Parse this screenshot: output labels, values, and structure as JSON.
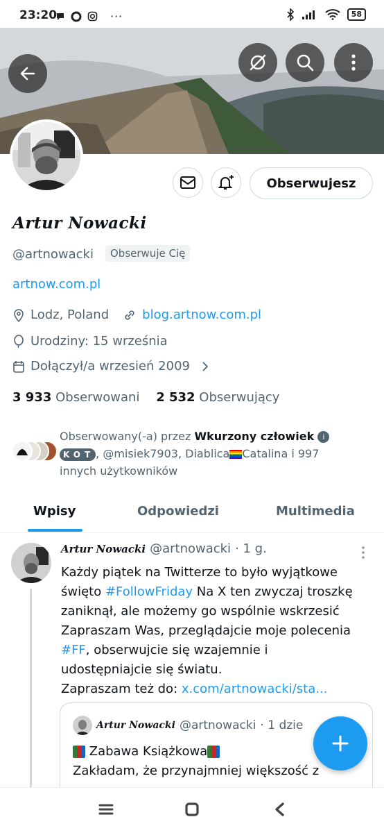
{
  "status_bar": {
    "time": "23:20",
    "battery": "58"
  },
  "header": {
    "back_icon": "arrow-left-icon",
    "grok_icon": "grok-icon",
    "search_icon": "search-icon",
    "more_icon": "more-vertical-icon"
  },
  "profile": {
    "display_name": "Artur Nowacki",
    "handle": "@artnowacki",
    "follows_you": "Obserwuje Cię",
    "website": "artnow.com.pl",
    "location": "Lodz, Poland",
    "blog_link": "blog.artnow.com.pl",
    "birthday": "Urodziny: 15 września",
    "joined": "Dołączył/a wrzesień 2009",
    "following_count": "3 933",
    "following_label": "Obserwowani",
    "followers_count": "2 532",
    "followers_label": "Obserwujący",
    "follow_button": "Obserwujesz",
    "followed_by_prefix": "Obserwowany(-a) przez",
    "followed_by_name": "Wkurzony człowiek",
    "followed_by_rest": "@misiek7903, Diablica",
    "followed_by_tail": "Catalina i 997 innych użytkowników",
    "kot_badge": "KOT"
  },
  "tabs": [
    {
      "label": "Wpisy"
    },
    {
      "label": "Odpowiedzi"
    },
    {
      "label": "Multimedia"
    }
  ],
  "tweet": {
    "author": "Artur Nowacki",
    "handle": "@artnowacki",
    "time": "· 1 g.",
    "line1": "Każdy piątek na Twitterze to było wyjątkowe",
    "line2_prefix": "święto ",
    "hashtag1": "#FollowFriday",
    "line2_suffix": " Na X ten zwyczaj troszkę",
    "line3": "zaniknął, ale możemy go wspólnie wskrzesić",
    "line4": "Zapraszam Was, przeglądajcie moje polecenia",
    "hashtag2": "#FF",
    "line5_suffix": ", obserwujcie się wzajemnie i",
    "line6": "udostępniajcie się światu.",
    "line7_prefix": "Zapraszam też do: ",
    "link": "x.com/artnowacki/sta..."
  },
  "quote": {
    "author": "Artur Nowacki",
    "handle": "@artnowacki",
    "time": "· 1 dzie",
    "line1": "Zabawa Książkowa",
    "line2": "Zakładam, że przynajmniej większość z"
  },
  "colors": {
    "accent": "#1d9bf0",
    "text": "#0f1419",
    "muted": "#536471"
  }
}
